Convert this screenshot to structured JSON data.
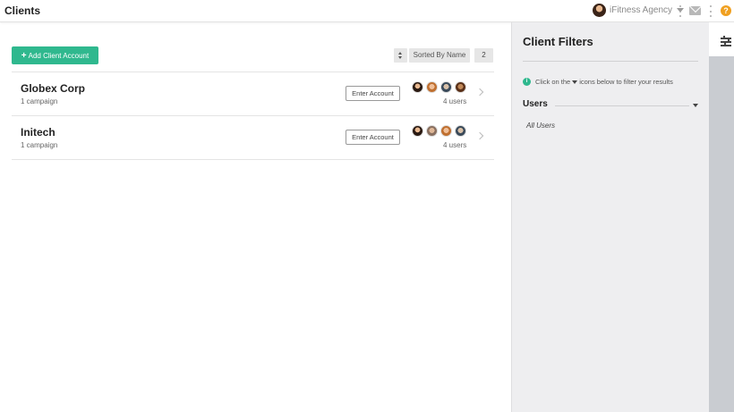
{
  "header": {
    "title": "Clients",
    "agency_name": "iFitness Agency",
    "icons": [
      "avatar",
      "chevron-down-icon",
      "kebab-icon",
      "mail-icon",
      "kebab-icon",
      "help-icon"
    ]
  },
  "toolbar": {
    "add_label": "Add Client Account",
    "add_icon": "+",
    "sort_label": "Sorted By Name",
    "count": "2"
  },
  "clients": [
    {
      "name": "Globex Corp",
      "campaigns": "1 campaign",
      "enter_label": "Enter Account",
      "users": "4 users"
    },
    {
      "name": "Initech",
      "campaigns": "1 campaign",
      "enter_label": "Enter Account",
      "users": "4 users"
    }
  ],
  "filters": {
    "title": "Client Filters",
    "info_prefix": "Click on the",
    "info_suffix": "icons below to filter your results",
    "users_label": "Users",
    "users_value": "All Users"
  },
  "colors": {
    "accent": "#2fb88e",
    "help": "#f0a020",
    "panel": "#eeeef0"
  }
}
